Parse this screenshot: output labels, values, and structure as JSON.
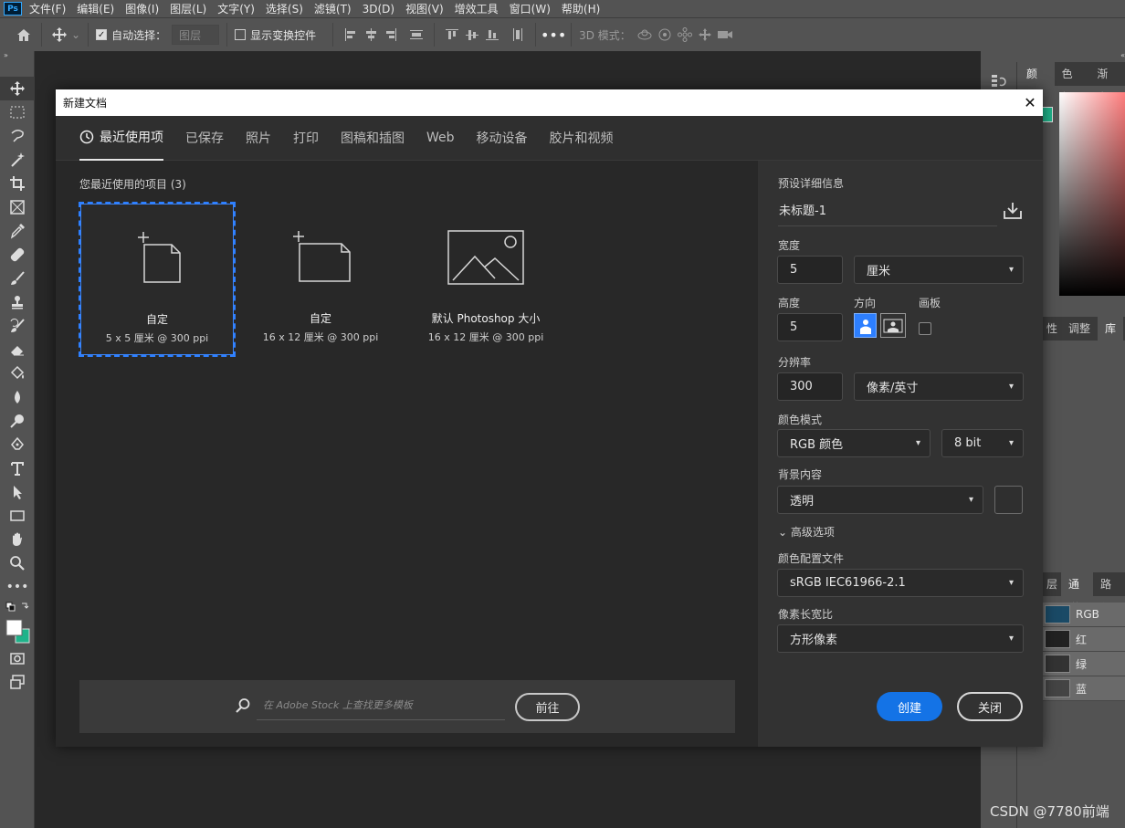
{
  "app": {
    "logo": "Ps",
    "menu": [
      "文件(F)",
      "编辑(E)",
      "图像(I)",
      "图层(L)",
      "文字(Y)",
      "选择(S)",
      "滤镜(T)",
      "3D(D)",
      "视图(V)",
      "增效工具",
      "窗口(W)",
      "帮助(H)"
    ]
  },
  "options_bar": {
    "auto_select_label": "自动选择：",
    "auto_select_value": "图层",
    "transform_controls_label": "显示变换控件",
    "mode_3d_label": "3D 模式："
  },
  "right_panel": {
    "top_tabs": [
      "颜色",
      "色板",
      "渐变"
    ],
    "mid_tabs": [
      "性",
      "调整",
      "库"
    ],
    "bottom_tabs": [
      "层",
      "通道",
      "路径"
    ],
    "channels": [
      "RGB",
      "红",
      "绿",
      "蓝"
    ]
  },
  "dialog": {
    "title": "新建文档",
    "tabs": [
      "最近使用项",
      "已保存",
      "照片",
      "打印",
      "图稿和插图",
      "Web",
      "移动设备",
      "胶片和视频"
    ],
    "recent_heading": "您最近使用的项目 (3)",
    "recent_items": [
      {
        "name": "自定",
        "size": "5 x 5 厘米 @ 300 ppi"
      },
      {
        "name": "自定",
        "size": "16 x 12 厘米 @ 300 ppi"
      },
      {
        "name": "默认 Photoshop 大小",
        "size": "16 x 12 厘米 @ 300 ppi"
      }
    ],
    "stock_placeholder": "在 Adobe Stock 上查找更多模板",
    "stock_go": "前往",
    "details": {
      "heading": "预设详细信息",
      "preset_name": "未标题-1",
      "width_label": "宽度",
      "width_value": "5",
      "width_unit": "厘米",
      "height_label": "高度",
      "height_value": "5",
      "orientation_label": "方向",
      "artboard_label": "画板",
      "resolution_label": "分辨率",
      "resolution_value": "300",
      "resolution_unit": "像素/英寸",
      "color_mode_label": "颜色模式",
      "color_mode": "RGB 颜色",
      "bit_depth": "8 bit",
      "bg_label": "背景内容",
      "bg_value": "透明",
      "advanced_label": "高级选项",
      "profile_label": "颜色配置文件",
      "profile_value": "sRGB IEC61966-2.1",
      "pixel_ratio_label": "像素长宽比",
      "pixel_ratio_value": "方形像素"
    },
    "create_label": "创建",
    "close_label": "关闭"
  },
  "watermark": "CSDN @7780前端",
  "colors": {
    "accent": "#1473e6",
    "selected_outline": "#2d7fff",
    "swatch_green": "#1fb38a"
  }
}
